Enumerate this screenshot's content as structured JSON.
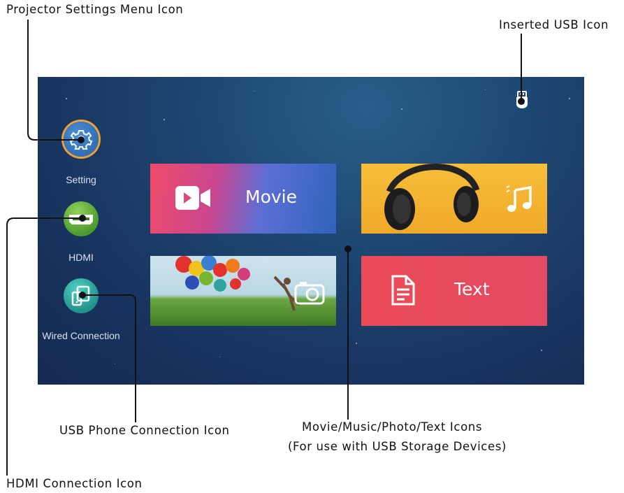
{
  "callouts": {
    "settings_icon": "Projector Settings Menu Icon",
    "usb_icon": "Inserted USB Icon",
    "usb_phone_icon": "USB Phone Connection Icon",
    "media_icons_line1": "Movie/Music/Photo/Text Icons",
    "media_icons_line2": "(For use with USB Storage Devices)",
    "hdmi_icon": "HDMI Connection Icon"
  },
  "sidebar": {
    "items": [
      {
        "label": "Setting",
        "icon": "gear-icon",
        "color": "#2f6fb5"
      },
      {
        "label": "HDMI",
        "icon": "hdmi-icon",
        "color": "#5aa43a"
      },
      {
        "label": "Wired Connection",
        "icon": "phone-screen-mirror-icon",
        "color": "#29a39a"
      }
    ]
  },
  "tiles": {
    "movie": {
      "label": "Movie",
      "icon": "video-camera-icon"
    },
    "music": {
      "icon": "music-note-icon"
    },
    "photo": {
      "icon": "camera-icon"
    },
    "text": {
      "label": "Text",
      "icon": "document-icon"
    }
  },
  "status": {
    "usb_icon": "usb-drive-icon"
  },
  "colors": {
    "screen_bg": "#1e4773",
    "text_tile": "#e84a5a",
    "music_tile": "#f2b32a",
    "settings_ring": "#f0a13a"
  }
}
